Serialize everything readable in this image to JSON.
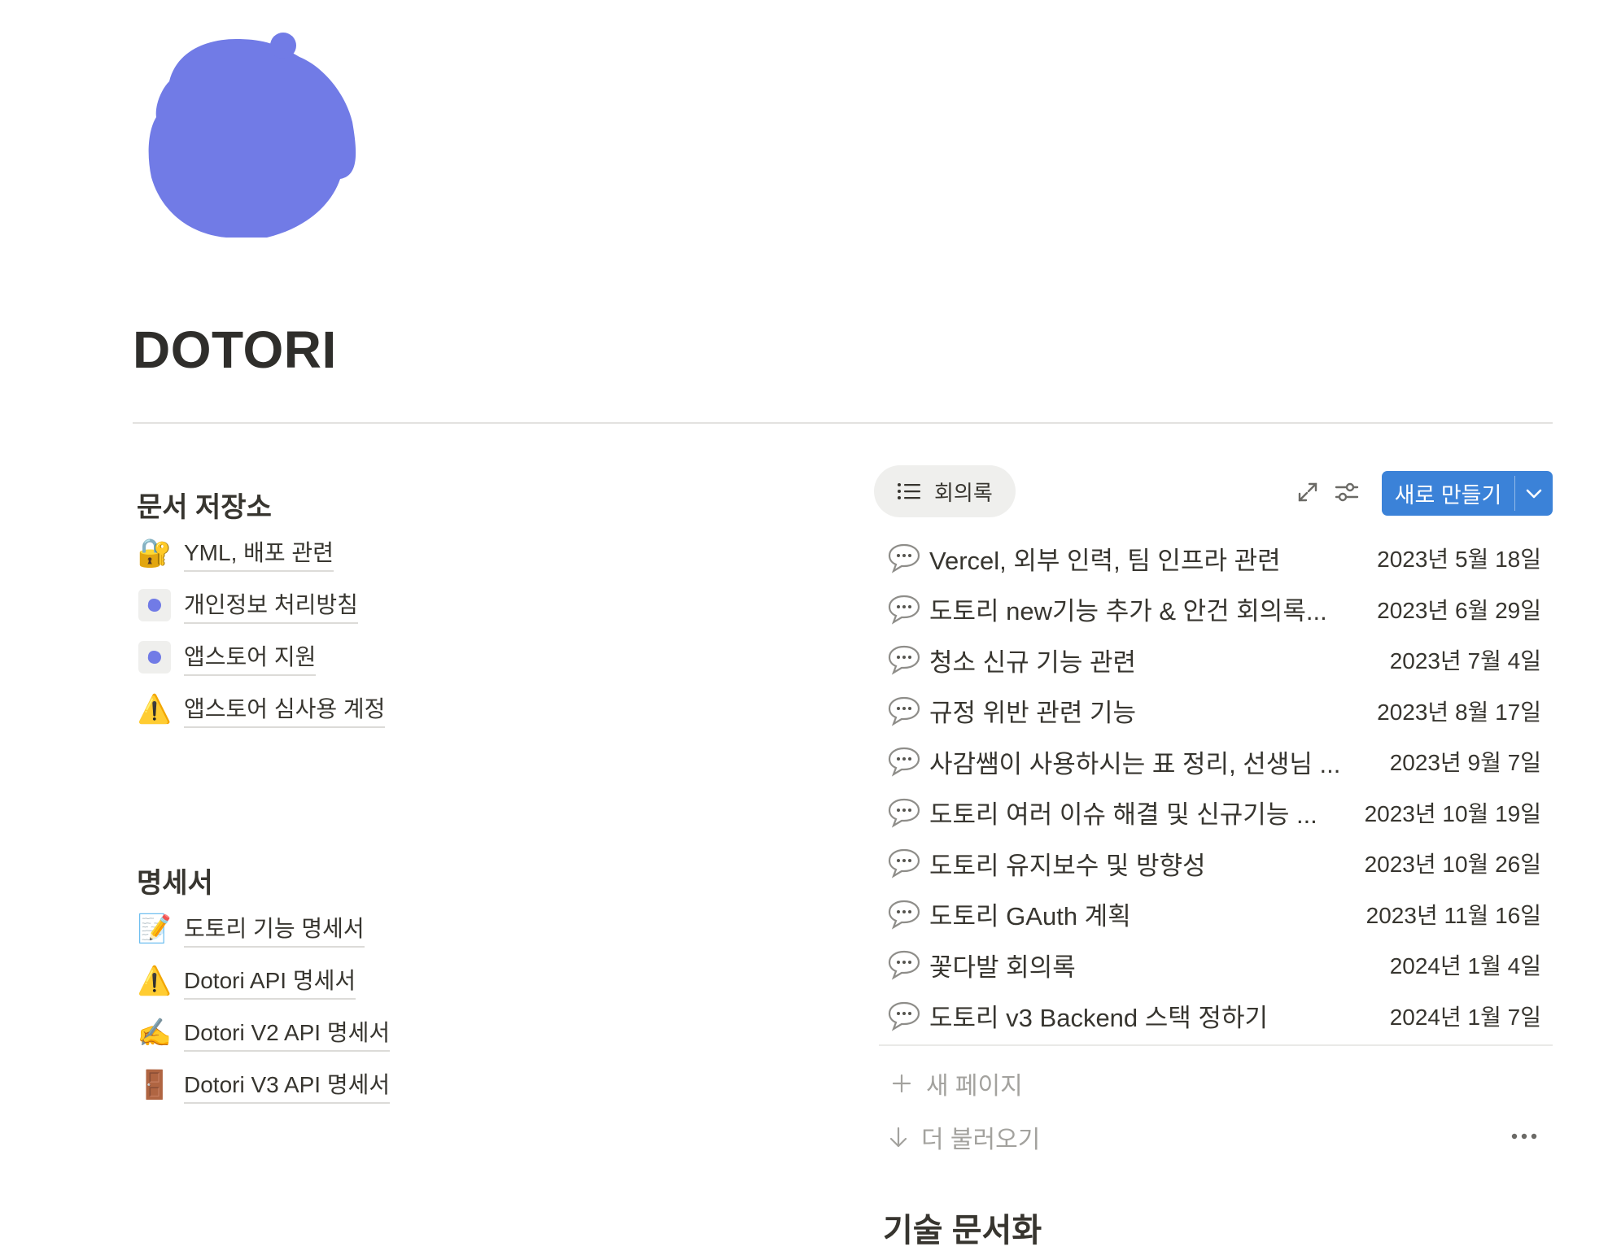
{
  "page": {
    "title": "DOTORI",
    "icon": "acorn-icon",
    "icon_color": "#717be6"
  },
  "sections": {
    "docs": {
      "title": "문서 저장소",
      "items": [
        {
          "icon": "lock-key-icon",
          "label": "YML, 배포 관련"
        },
        {
          "icon": "acorn-dot-icon",
          "label": "개인정보 처리방침"
        },
        {
          "icon": "acorn-dot-icon",
          "label": "앱스토어 지원"
        },
        {
          "icon": "warning-icon",
          "label": "앱스토어 심사용 계정"
        }
      ]
    },
    "specs": {
      "title": "명세서",
      "items": [
        {
          "icon": "memo-icon",
          "label": "도토리 기능 명세서"
        },
        {
          "icon": "warning-icon",
          "label": "Dotori API 명세서"
        },
        {
          "icon": "writing-hand-icon",
          "label": "Dotori V2 API 명세서"
        },
        {
          "icon": "door-icon",
          "label": "Dotori V3 API 명세서"
        }
      ]
    },
    "tech_docs": {
      "title": "기술 문서화"
    }
  },
  "database": {
    "view_tab": "회의록",
    "new_button": "새로 만들기",
    "accent_color": "#3b82d8",
    "rows": [
      {
        "title": "Vercel, 외부 인력, 팀 인프라 관련",
        "date": "2023년 5월 18일"
      },
      {
        "title": "도토리 new기능 추가 & 안건 회의록...",
        "date": "2023년 6월 29일"
      },
      {
        "title": "청소 신규 기능 관련",
        "date": "2023년 7월 4일"
      },
      {
        "title": "규정 위반 관련 기능",
        "date": "2023년 8월 17일"
      },
      {
        "title": "사감쌤이 사용하시는 표 정리, 선생님 ...",
        "date": "2023년 9월 7일"
      },
      {
        "title": "도토리 여러 이슈 해결 및 신규기능 ...",
        "date": "2023년 10월 19일"
      },
      {
        "title": "도토리 유지보수 및 방향성",
        "date": "2023년 10월 26일"
      },
      {
        "title": "도토리 GAuth 계획",
        "date": "2023년 11월 16일"
      },
      {
        "title": "꽃다발 회의록",
        "date": "2024년 1월 4일"
      },
      {
        "title": "도토리 v3 Backend 스택 정하기",
        "date": "2024년 1월 7일"
      }
    ],
    "new_page": "새 페이지",
    "load_more": "더 불러오기"
  }
}
